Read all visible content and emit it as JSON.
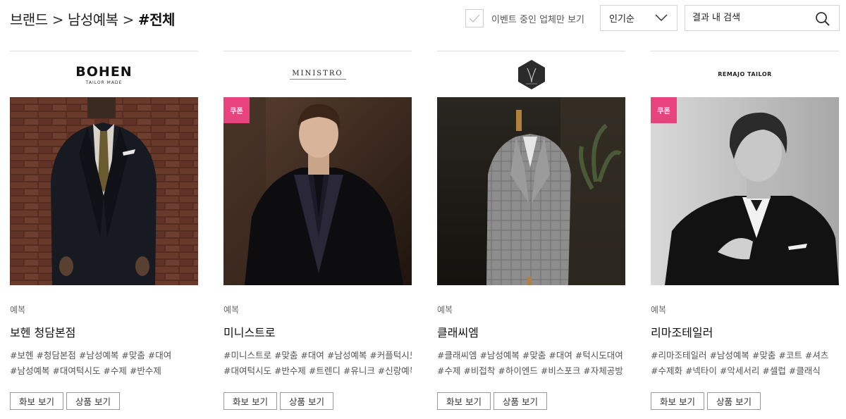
{
  "breadcrumb": {
    "items": [
      "브랜드",
      "남성예복"
    ],
    "separator": ">",
    "current": "#전체"
  },
  "filters": {
    "event_only_label": "이벤트 중인 업체만 보기",
    "sort_selected": "인기순",
    "search_placeholder": "결과 내 검색"
  },
  "colors": {
    "coupon_badge": "#e8437c",
    "border": "#d4d4d4",
    "text": "#222222"
  },
  "cards": [
    {
      "logo_text": "BOHEN",
      "logo_sub": "TAILOR MADE",
      "coupon": "",
      "category": "예복",
      "name": "보헨 청담본점",
      "tags_line1": "#보헨 #청담본점 #남성예복 #맞춤 #대여",
      "tags_line2": "#남성예복 #대여턱시도 #수제 #반수제",
      "gallery_btn": "화보 보기",
      "product_btn": "상품 보기"
    },
    {
      "logo_text": "MINISTRO",
      "logo_sub": "",
      "coupon": "쿠폰",
      "category": "예복",
      "name": "미니스트로",
      "tags_line1": "#미니스트로 #맞춤 #대여 #남성예복 #커플턱시도",
      "tags_line2": "#대여턱시도 #반수제 #트렌디 #유니크 #신랑예복",
      "gallery_btn": "화보 보기",
      "product_btn": "상품 보기"
    },
    {
      "logo_text": "",
      "logo_sub": "",
      "coupon": "",
      "category": "예복",
      "name": "클래씨엠",
      "tags_line1": "#클래씨엠 #남성예복 #맞춤 #대여 #턱시도대여",
      "tags_line2": "#수제 #비접착 #하이엔드 #비스포크 #자체공방",
      "gallery_btn": "화보 보기",
      "product_btn": "상품 보기"
    },
    {
      "logo_text": "REMAJO TAILOR",
      "logo_sub": "",
      "coupon": "쿠폰",
      "category": "예복",
      "name": "리마조테일러",
      "tags_line1": "#리마조테일러 #남성예복 #맞춤 #코트 #셔츠",
      "tags_line2": "#수제화 #넥타이 #악세서리 #셀럽 #클래식",
      "gallery_btn": "화보 보기",
      "product_btn": "상품 보기"
    }
  ]
}
